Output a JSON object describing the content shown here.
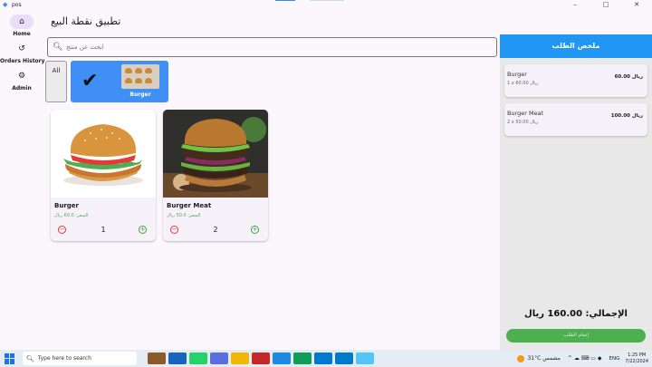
{
  "window": {
    "title": "pos",
    "minimize_icon": "–",
    "maximize_icon": "□",
    "close_icon": "✕"
  },
  "nav": {
    "items": [
      {
        "label": "Home",
        "icon": "home-icon",
        "glyph": "⌂"
      },
      {
        "label": "Orders History",
        "icon": "history-icon",
        "glyph": "↺"
      },
      {
        "label": "Admin",
        "icon": "admin-icon",
        "glyph": "⚙"
      }
    ]
  },
  "page": {
    "title": "تطبيق نقطة البيع"
  },
  "search": {
    "placeholder": "ابحث عن منتج"
  },
  "categories": {
    "all_label": "All",
    "selected": {
      "label": "Burger"
    }
  },
  "products": [
    {
      "name": "Burger",
      "price_label": "السعر: 60.0 ريال",
      "quantity": "1"
    },
    {
      "name": "Burger Meat",
      "price_label": "السعر: 50.0 ريال",
      "quantity": "2"
    }
  ],
  "summary": {
    "title": "ملخص الطلب",
    "items": [
      {
        "name": "Burger",
        "detail": "1 x 60.00 ريال",
        "total": "60.00 ريال"
      },
      {
        "name": "Burger Meat",
        "detail": "2 x 50.00 ريال",
        "total": "100.00 ريال"
      }
    ],
    "total_label": "الإجمالي: 160.00 ريال",
    "complete_label": "إتمام الطلب"
  },
  "taskbar": {
    "search_placeholder": "Type here to search",
    "weather": "31°C  مشمس",
    "language": "ENG",
    "time": "1:25 PM",
    "date": "7/22/2024"
  },
  "colors": {
    "primary": "#2196f3",
    "selected_chip": "#3f8ff5",
    "success": "#4caf50",
    "danger": "#e53935",
    "rail_indicator": "#e8def8"
  }
}
